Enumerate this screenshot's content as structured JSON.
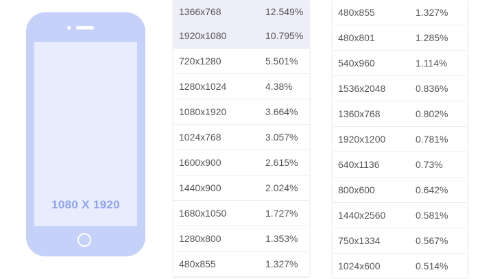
{
  "phone": {
    "screen_label": "1080 X 1920"
  },
  "left_table": {
    "rows": [
      {
        "resolution": "1366x768",
        "percent": "12.549%"
      },
      {
        "resolution": "1920x1080",
        "percent": "10.795%"
      },
      {
        "resolution": "720x1280",
        "percent": "5.501%"
      },
      {
        "resolution": "1280x1024",
        "percent": "4.38%"
      },
      {
        "resolution": "1080x1920",
        "percent": "3.664%"
      },
      {
        "resolution": "1024x768",
        "percent": "3.057%"
      },
      {
        "resolution": "1600x900",
        "percent": "2.615%"
      },
      {
        "resolution": "1440x900",
        "percent": "2.024%"
      },
      {
        "resolution": "1680x1050",
        "percent": "1.727%"
      },
      {
        "resolution": "1280x800",
        "percent": "1.353%"
      },
      {
        "resolution": "480x855",
        "percent": "1.327%"
      }
    ]
  },
  "right_table": {
    "rows": [
      {
        "resolution": "480x855",
        "percent": "1.327%"
      },
      {
        "resolution": "480x801",
        "percent": "1.285%"
      },
      {
        "resolution": "540x960",
        "percent": "1.114%"
      },
      {
        "resolution": "1536x2048",
        "percent": "0.836%"
      },
      {
        "resolution": "1360x768",
        "percent": "0.802%"
      },
      {
        "resolution": "1920x1200",
        "percent": "0.781%"
      },
      {
        "resolution": "640x1136",
        "percent": "0.73%"
      },
      {
        "resolution": "800x600",
        "percent": "0.642%"
      },
      {
        "resolution": "1440x2560",
        "percent": "0.581%"
      },
      {
        "resolution": "750x1334",
        "percent": "0.567%"
      },
      {
        "resolution": "1024x600",
        "percent": "0.514%"
      }
    ]
  },
  "colors": {
    "phone_body": "#c5d1f9",
    "phone_screen": "#e8ecfd",
    "phone_label": "#90a4ef",
    "row_highlight": "#eeeef8"
  }
}
